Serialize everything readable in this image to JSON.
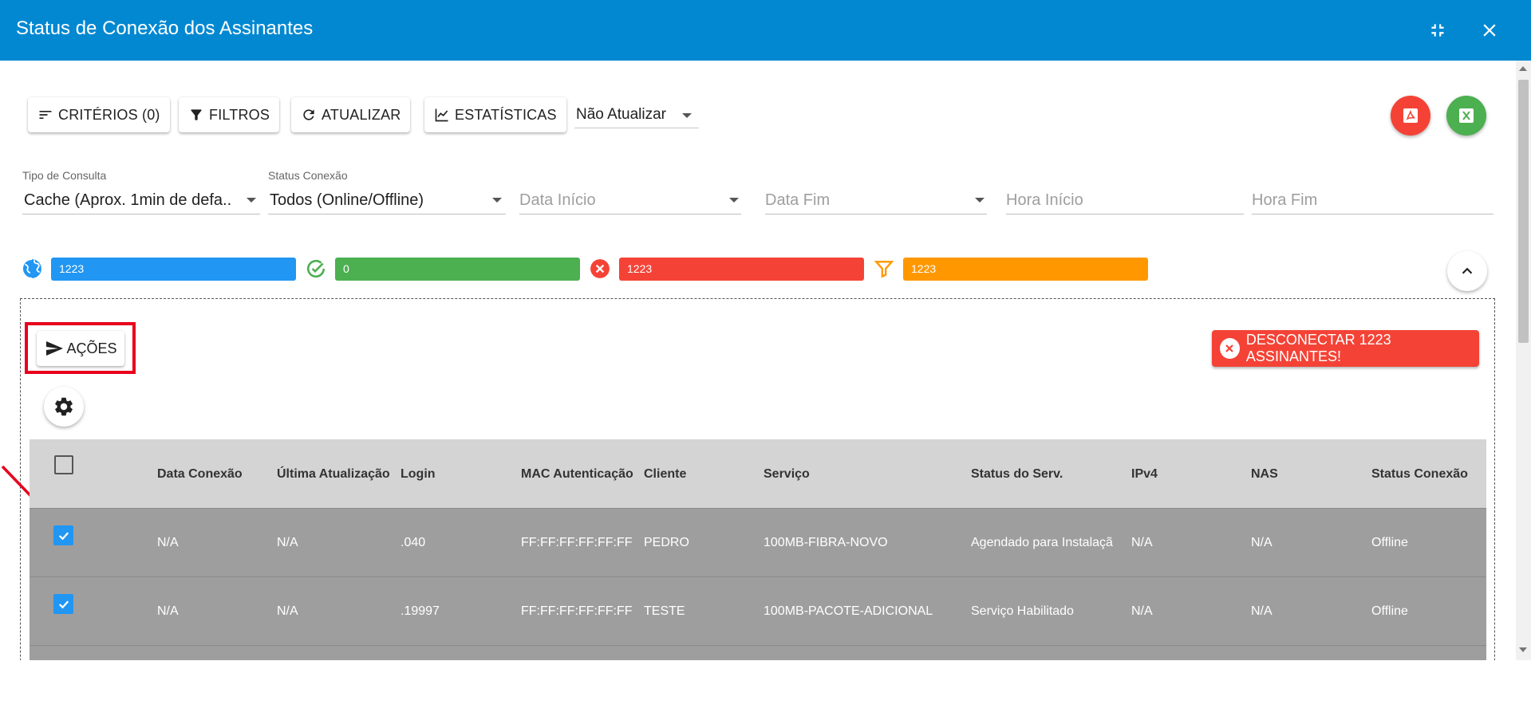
{
  "header": {
    "title": "Status de Conexão dos Assinantes",
    "color": "#0288d1",
    "icons": [
      "collapse-icon",
      "close-icon"
    ]
  },
  "toolbar": {
    "criterios_label": "CRITÉRIOS (0)",
    "filtros_label": "FILTROS",
    "atualizar_label": "ATUALIZAR",
    "estatisticas_label": "ESTATÍSTICAS",
    "auto_refresh_value": "Não Atualizar",
    "pdf_color": "#f44336",
    "excel_color": "#4caf50"
  },
  "filters": {
    "tipo_consulta": {
      "label": "Tipo de Consulta",
      "value": "Cache (Aprox. 1min de defa..."
    },
    "status_conexao": {
      "label": "Status Conexão",
      "value": "Todos (Online/Offline)"
    },
    "data_inicio": {
      "placeholder": "Data Início"
    },
    "data_fim": {
      "placeholder": "Data Fim"
    },
    "hora_inicio": {
      "placeholder": "Hora Início"
    },
    "hora_fim": {
      "placeholder": "Hora Fim"
    }
  },
  "counters": {
    "total": {
      "value": "1223",
      "color": "#2196f3",
      "icon": "globe-icon"
    },
    "online": {
      "value": "0",
      "color": "#4caf50",
      "icon": "check-circle-icon"
    },
    "offline": {
      "value": "1223",
      "color": "#f44336",
      "icon": "error-circle-icon"
    },
    "filtered": {
      "value": "1223",
      "color": "#ff9800",
      "icon": "filter-icon"
    }
  },
  "actions": {
    "acoes_label": "AÇÕES",
    "disconnect_label": "DESCONECTAR 1223 ASSINANTES!"
  },
  "table": {
    "columns": [
      "Data Conexão",
      "Última Atualização",
      "Login",
      "MAC Autenticação",
      "Cliente",
      "Serviço",
      "Status do Serv.",
      "IPv4",
      "NAS",
      "Status Conexão"
    ],
    "rows": [
      {
        "selected": true,
        "cells": [
          "N/A",
          "N/A",
          ".040",
          "FF:FF:FF:FF:FF:FF",
          "PEDRO",
          "100MB-FIBRA-NOVO",
          "Agendado para Instalaçã",
          "N/A",
          "N/A",
          "Offline"
        ]
      },
      {
        "selected": true,
        "cells": [
          "N/A",
          "N/A",
          ".19997",
          "FF:FF:FF:FF:FF:FF",
          "TESTE",
          "100MB-PACOTE-ADICIONAL",
          "Serviço Habilitado",
          "N/A",
          "N/A",
          "Offline"
        ]
      }
    ]
  }
}
